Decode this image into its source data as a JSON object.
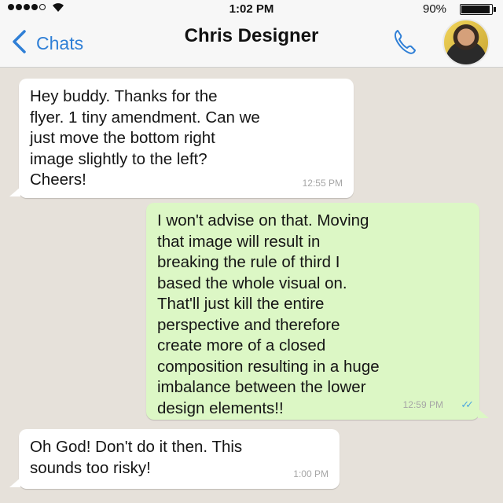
{
  "status_bar": {
    "time": "1:02 PM",
    "battery_label": "90%",
    "battery_level": 0.9
  },
  "nav": {
    "back_label": "Chats",
    "contact_name": "Chris Designer",
    "icons": [
      "chevron-left-icon",
      "phone-icon",
      "contact-avatar"
    ]
  },
  "messages": [
    {
      "direction": "incoming",
      "text": "Hey buddy. Thanks for the\nflyer. 1 tiny amendment. Can we\njust move the bottom right\nimage slightly to the left?\nCheers!",
      "time": "12:55 PM"
    },
    {
      "direction": "outgoing",
      "text": "I won't advise on that. Moving\nthat image will result in\nbreaking the rule of third I\nbased the whole visual on.\nThat'll just kill the entire\nperspective and therefore\ncreate more of a closed\ncomposition resulting in a huge\nimbalance between the lower\ndesign elements!!",
      "time": "12:59 PM",
      "status": "read"
    },
    {
      "direction": "incoming",
      "text": "Oh God! Don't do it then. This\nsounds too risky!",
      "time": "1:00 PM"
    }
  ],
  "colors": {
    "accent": "#2f7fd6",
    "outgoing_bubble": "#dcf7c5",
    "incoming_bubble": "#ffffff",
    "chat_background": "#e6e1da",
    "read_ticks": "#4fa8de"
  }
}
